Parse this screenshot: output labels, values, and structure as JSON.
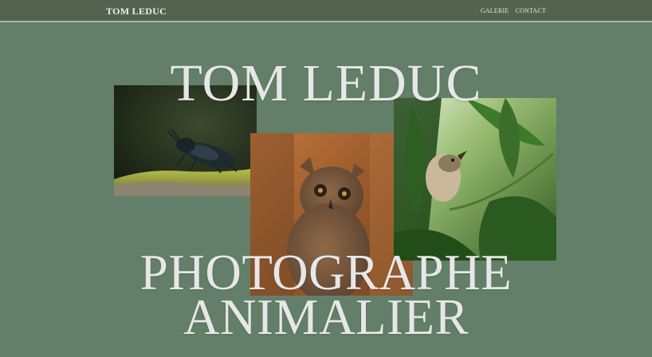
{
  "nav": {
    "brand": "TOM LEDUC",
    "links": [
      "GALERIE",
      "CONTACT"
    ]
  },
  "hero": {
    "name": "TOM LEDUC",
    "line1": "PHOTOGRAPHE",
    "line2": "ANIMALIER"
  },
  "photos": [
    {
      "subject": "beetle-icon"
    },
    {
      "subject": "owl-icon"
    },
    {
      "subject": "bird-icon"
    }
  ],
  "colors": {
    "background": "#637f69",
    "navbar": "#53634f",
    "hero_text": "#e7e7e7"
  }
}
